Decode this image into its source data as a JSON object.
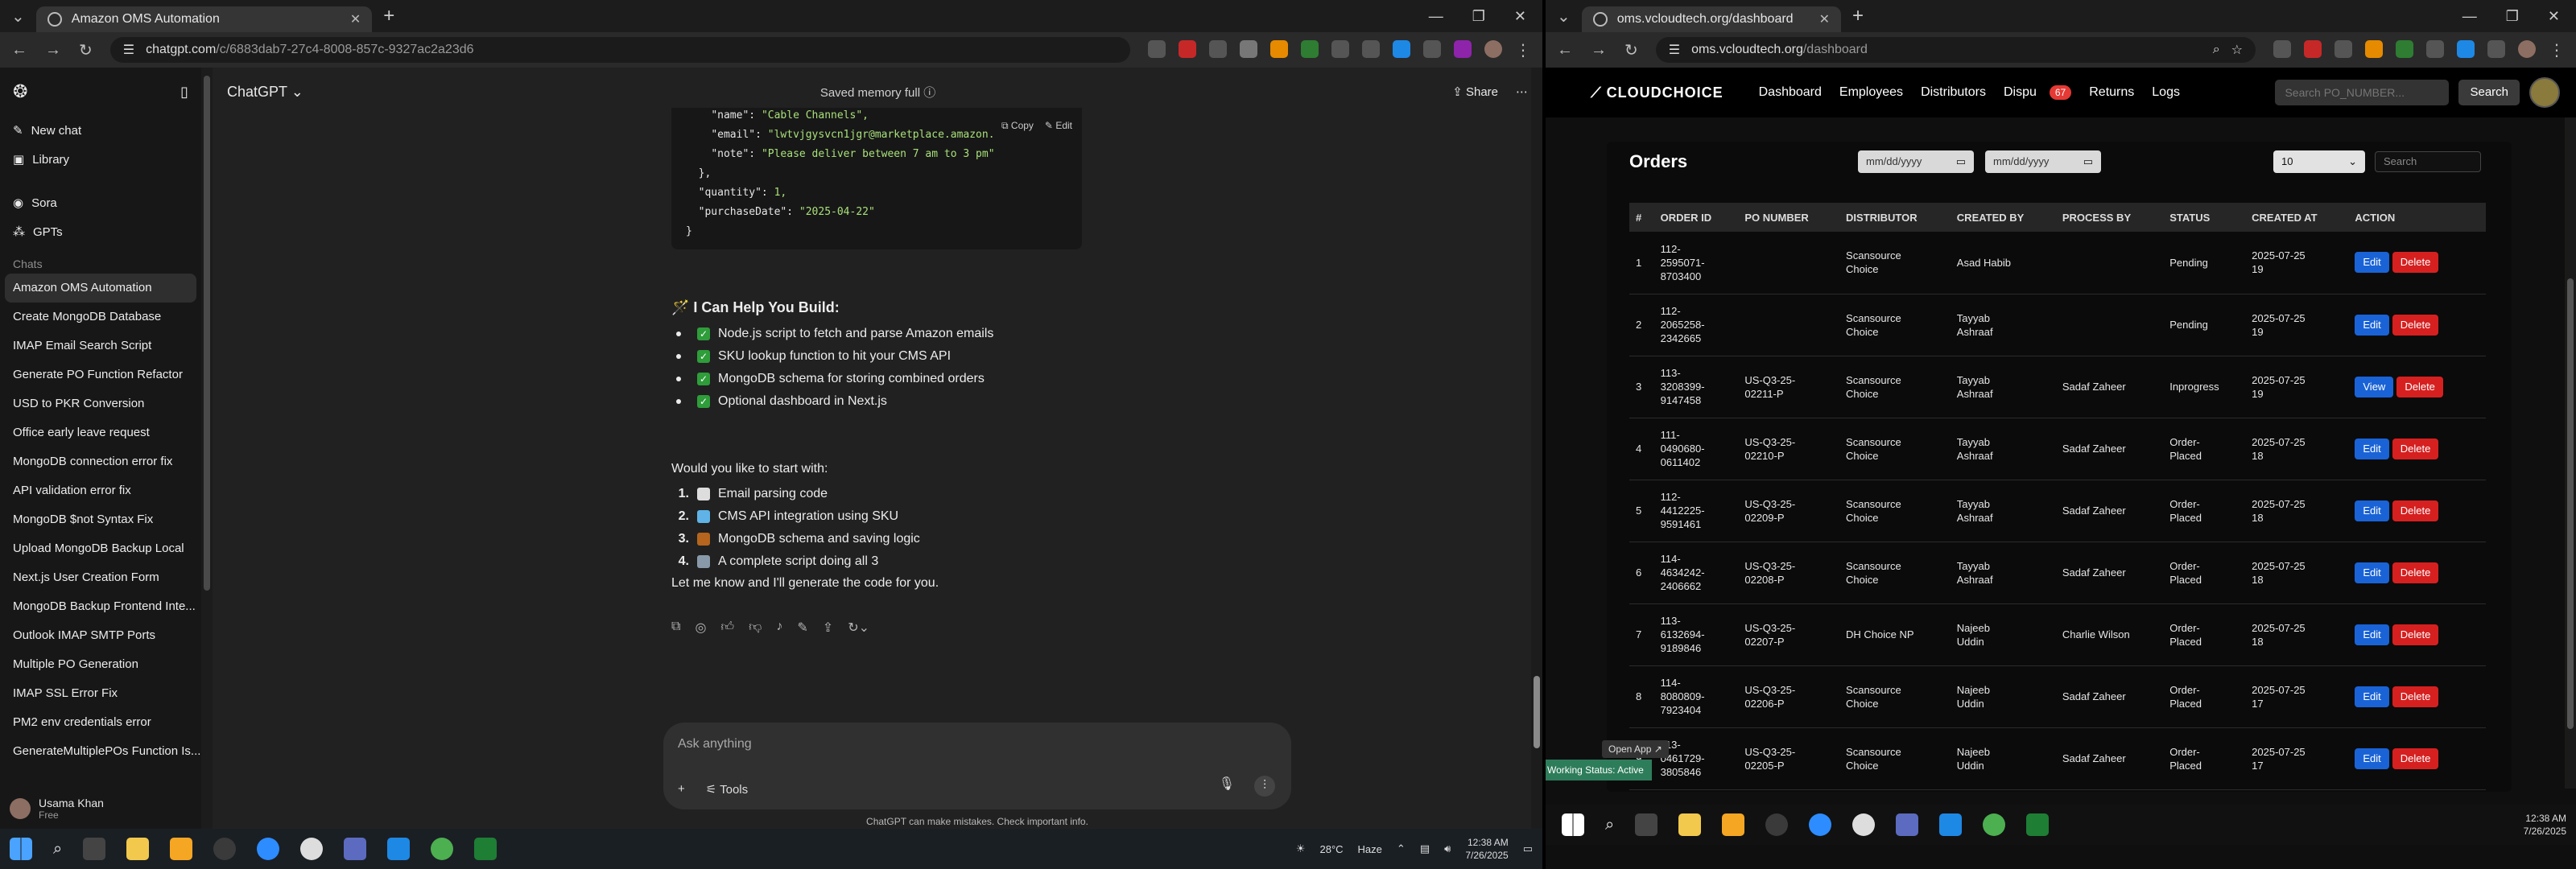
{
  "left_browser": {
    "tab_title": "Amazon OMS Automation",
    "url_host": "chatgpt.com",
    "url_path": "/c/6883dab7-27c4-8008-857c-9327ac2a23d6"
  },
  "chatgpt": {
    "new_chat": "New chat",
    "library": "Library",
    "sora": "Sora",
    "gpts": "GPTs",
    "chats_label": "Chats",
    "chats": [
      "Amazon OMS Automation",
      "Create MongoDB Database",
      "IMAP Email Search Script",
      "Generate PO Function Refactor",
      "USD to PKR Conversion",
      "Office early leave request",
      "MongoDB connection error fix",
      "API validation error fix",
      "MongoDB $not Syntax Fix",
      "Upload MongoDB Backup Local",
      "Next.js User Creation Form",
      "MongoDB Backup Frontend Inte...",
      "Outlook IMAP SMTP Ports",
      "Multiple PO Generation",
      "IMAP SSL Error Fix",
      "PM2 env credentials error",
      "GenerateMultiplePOs Function Is..."
    ],
    "user_name": "Usama Khan",
    "user_plan": "Free",
    "model": "ChatGPT",
    "memory": "Saved memory full",
    "share": "Share",
    "code_copy": "Copy",
    "code_edit": "Edit",
    "code_lines": [
      {
        "indent": "    ",
        "key": "\"name\": ",
        "val": "\"Cable Channels\","
      },
      {
        "indent": "    ",
        "key": "\"email\": ",
        "val": "\"lwtvjgysvcn1jgr@marketplace.amazon."
      },
      {
        "indent": "    ",
        "key": "\"note\": ",
        "val": "\"Please deliver between 7 am to 3 pm\""
      },
      {
        "indent": "  ",
        "key": "},",
        "val": ""
      },
      {
        "indent": "  ",
        "key": "\"quantity\": ",
        "val": "1,"
      },
      {
        "indent": "  ",
        "key": "\"purchaseDate\": ",
        "val": "\"2025-04-22\""
      },
      {
        "indent": "",
        "key": "}",
        "val": ""
      }
    ],
    "help_heading": "🪄 I Can Help You Build:",
    "help_items": [
      "Node.js script to fetch and parse Amazon emails",
      "SKU lookup function to hit your CMS API",
      "MongoDB schema for storing combined orders",
      "Optional dashboard in Next.js"
    ],
    "start_question": "Would you like to start with:",
    "start_items": [
      {
        "n": "1.",
        "text": "Email parsing code"
      },
      {
        "n": "2.",
        "text": "CMS API integration using SKU"
      },
      {
        "n": "3.",
        "text": "MongoDB schema and saving logic"
      },
      {
        "n": "4.",
        "text": "A complete script doing all 3"
      }
    ],
    "closing": "Let me know and I'll generate the code for you.",
    "composer_placeholder": "Ask anything",
    "tools": "Tools",
    "disclaimer": "ChatGPT can make mistakes. Check important info."
  },
  "taskbar_left": {
    "weather": "28°C",
    "weather_desc": "Haze",
    "time": "12:38 AM",
    "date": "7/26/2025"
  },
  "right_browser": {
    "url_host": "oms.vcloudtech.org",
    "url_path": "/dashboard",
    "time": "12:38 AM",
    "date": "7/26/2025"
  },
  "oms": {
    "logo": "CLOUDCHOICE",
    "nav": [
      "Dashboard",
      "Employees",
      "Distributors",
      "Dispu"
    ],
    "badge": "67",
    "nav_after": [
      "Returns",
      "Logs"
    ],
    "search_placeholder": "Search PO_NUMBER...",
    "search_btn": "Search",
    "title": "Orders",
    "date_from": "mm/dd/yyyy",
    "date_to": "mm/dd/yyyy",
    "page_size": "10",
    "table_search": "Search",
    "columns": [
      "#",
      "ORDER ID",
      "PO NUMBER",
      "DISTRIBUTOR",
      "CREATED BY",
      "PROCESS BY",
      "STATUS",
      "CREATED AT",
      "ACTION"
    ],
    "rows": [
      {
        "n": "1",
        "order": "112-\n2595071-\n8703400",
        "po": "",
        "dist": "Scansource\nChoice",
        "by": "Asad Habib",
        "proc": "",
        "status": "Pending",
        "at": "2025-07-25\n19",
        "primary": "Edit"
      },
      {
        "n": "2",
        "order": "112-\n2065258-\n2342665",
        "po": "",
        "dist": "Scansource\nChoice",
        "by": "Tayyab\nAshraaf",
        "proc": "",
        "status": "Pending",
        "at": "2025-07-25\n19",
        "primary": "Edit"
      },
      {
        "n": "3",
        "order": "113-\n3208399-\n9147458",
        "po": "US-Q3-25-\n02211-P",
        "dist": "Scansource\nChoice",
        "by": "Tayyab\nAshraaf",
        "proc": "Sadaf Zaheer",
        "status": "Inprogress",
        "at": "2025-07-25\n19",
        "primary": "View"
      },
      {
        "n": "4",
        "order": "111-\n0490680-\n0611402",
        "po": "US-Q3-25-\n02210-P",
        "dist": "Scansource\nChoice",
        "by": "Tayyab\nAshraaf",
        "proc": "Sadaf Zaheer",
        "status": "Order-\nPlaced",
        "at": "2025-07-25\n18",
        "primary": "Edit"
      },
      {
        "n": "5",
        "order": "112-\n4412225-\n9591461",
        "po": "US-Q3-25-\n02209-P",
        "dist": "Scansource\nChoice",
        "by": "Tayyab\nAshraaf",
        "proc": "Sadaf Zaheer",
        "status": "Order-\nPlaced",
        "at": "2025-07-25\n18",
        "primary": "Edit"
      },
      {
        "n": "6",
        "order": "114-\n4634242-\n2406662",
        "po": "US-Q3-25-\n02208-P",
        "dist": "Scansource\nChoice",
        "by": "Tayyab\nAshraaf",
        "proc": "Sadaf Zaheer",
        "status": "Order-\nPlaced",
        "at": "2025-07-25\n18",
        "primary": "Edit"
      },
      {
        "n": "7",
        "order": "113-\n6132694-\n9189846",
        "po": "US-Q3-25-\n02207-P",
        "dist": "DH Choice NP",
        "by": "Najeeb\nUddin",
        "proc": "Charlie Wilson",
        "status": "Order-\nPlaced",
        "at": "2025-07-25\n18",
        "primary": "Edit"
      },
      {
        "n": "8",
        "order": "114-\n8080809-\n7923404",
        "po": "US-Q3-25-\n02206-P",
        "dist": "Scansource\nChoice",
        "by": "Najeeb\nUddin",
        "proc": "Sadaf Zaheer",
        "status": "Order-\nPlaced",
        "at": "2025-07-25\n17",
        "primary": "Edit"
      },
      {
        "n": "9",
        "order": "113-\n0461729-\n3805846",
        "po": "US-Q3-25-\n02205-P",
        "dist": "Scansource\nChoice",
        "by": "Najeeb\nUddin",
        "proc": "Sadaf Zaheer",
        "status": "Order-\nPlaced",
        "at": "2025-07-25\n17",
        "primary": "Edit"
      }
    ],
    "delete": "Delete",
    "working_status": "Working Status: Active",
    "open_app": "Open App"
  }
}
